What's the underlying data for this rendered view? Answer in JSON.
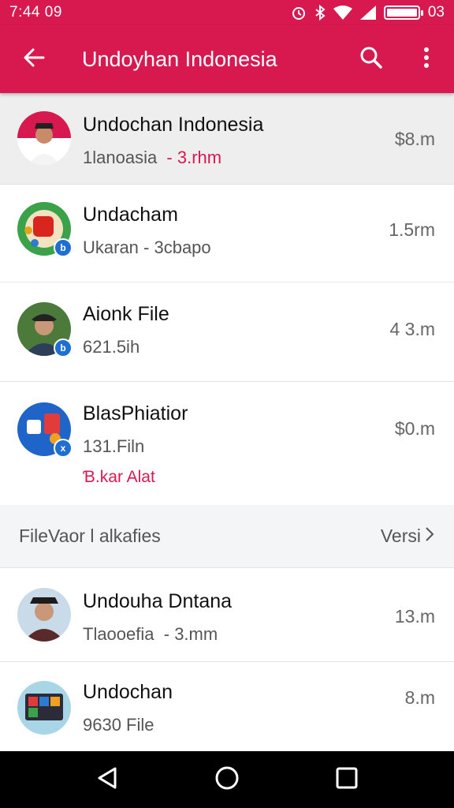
{
  "status_bar": {
    "time": "7:44 09",
    "battery_level_percent": 100,
    "battery_text": "03",
    "icons": [
      "alarm-icon",
      "bluetooth-icon",
      "wifi-icon",
      "signal-icon",
      "battery-icon"
    ]
  },
  "app_bar": {
    "title": "Undoyhan Indonesia",
    "color": "#d8194f",
    "back_icon": "arrow-back-icon",
    "search_icon": "search-icon",
    "menu_icon": "more-vert-icon"
  },
  "items": [
    {
      "title": "Undochan Indonesia",
      "sub_main": "1lanoasia",
      "sub_accent": "- 3.rhm",
      "size": "$8.m",
      "selected": true,
      "badge": ""
    },
    {
      "title": "Undacham",
      "sub_main": "Ukaran - 3cbapo",
      "sub_accent": "",
      "size": "1.5rm",
      "selected": false,
      "badge": "b"
    },
    {
      "title": "Aionk File",
      "sub_main": "621.5ih",
      "sub_accent": "",
      "size": "4 3.m",
      "selected": false,
      "badge": "b"
    },
    {
      "title": "BlasPhiatior",
      "sub_main": "131.Filn",
      "sub_accent": "",
      "extra": "Ɓ.kar Alat",
      "size": "$0.m",
      "selected": false,
      "badge": "x"
    }
  ],
  "section": {
    "title": "FileVaor l alkafies",
    "link": "Versi"
  },
  "items_after": [
    {
      "title": "Undouha Dntana",
      "sub_main": "Tlaooefia",
      "sub_accent": "- 3.mm",
      "size": "13.m",
      "badge": ""
    },
    {
      "title": "Undochan",
      "sub_main": "9630 File",
      "sub_accent": "",
      "size": "8.m",
      "badge": ""
    }
  ],
  "nav": {
    "back_icon": "nav-back-icon",
    "home_icon": "nav-home-icon",
    "recents_icon": "nav-recents-icon"
  }
}
